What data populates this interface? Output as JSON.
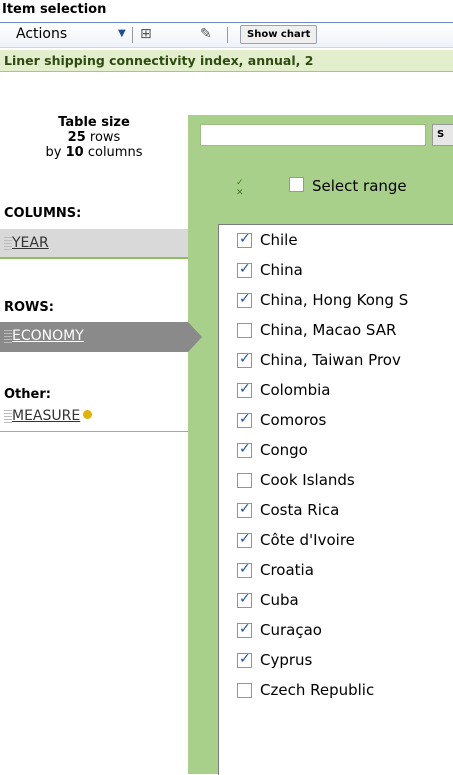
{
  "title": "Item selection",
  "toolbar": {
    "actions_label": "Actions",
    "arrow": "▼",
    "icon1": "⊞",
    "icon2": "✎",
    "show_chart": "Show chart"
  },
  "subtitle": "Liner shipping connectivity index, annual, 2",
  "table_size": {
    "heading": "Table size",
    "rows_count": "25",
    "rows_label": "rows",
    "by": "by",
    "cols_count": "10",
    "cols_label": "columns"
  },
  "columns_label": "COLUMNS:",
  "year": "YEAR",
  "rows_label": "ROWS:",
  "economy": "ECONOMY",
  "other_label": "Other:",
  "measure": "MEASURE",
  "search": {
    "button": "S"
  },
  "select_range": "Select range",
  "mini_icons": "✓\n✕",
  "items": [
    {
      "label": "Chile",
      "checked": true
    },
    {
      "label": "China",
      "checked": true
    },
    {
      "label": "China, Hong Kong S",
      "checked": true
    },
    {
      "label": "China, Macao SAR",
      "checked": false
    },
    {
      "label": "China, Taiwan Prov",
      "checked": true
    },
    {
      "label": "Colombia",
      "checked": true
    },
    {
      "label": "Comoros",
      "checked": true
    },
    {
      "label": "Congo",
      "checked": true
    },
    {
      "label": "Cook Islands",
      "checked": false
    },
    {
      "label": "Costa Rica",
      "checked": true
    },
    {
      "label": "Côte d'Ivoire",
      "checked": true
    },
    {
      "label": "Croatia",
      "checked": true
    },
    {
      "label": "Cuba",
      "checked": true
    },
    {
      "label": "Curaçao",
      "checked": true
    },
    {
      "label": "Cyprus",
      "checked": true
    },
    {
      "label": "Czech Republic",
      "checked": false
    }
  ]
}
